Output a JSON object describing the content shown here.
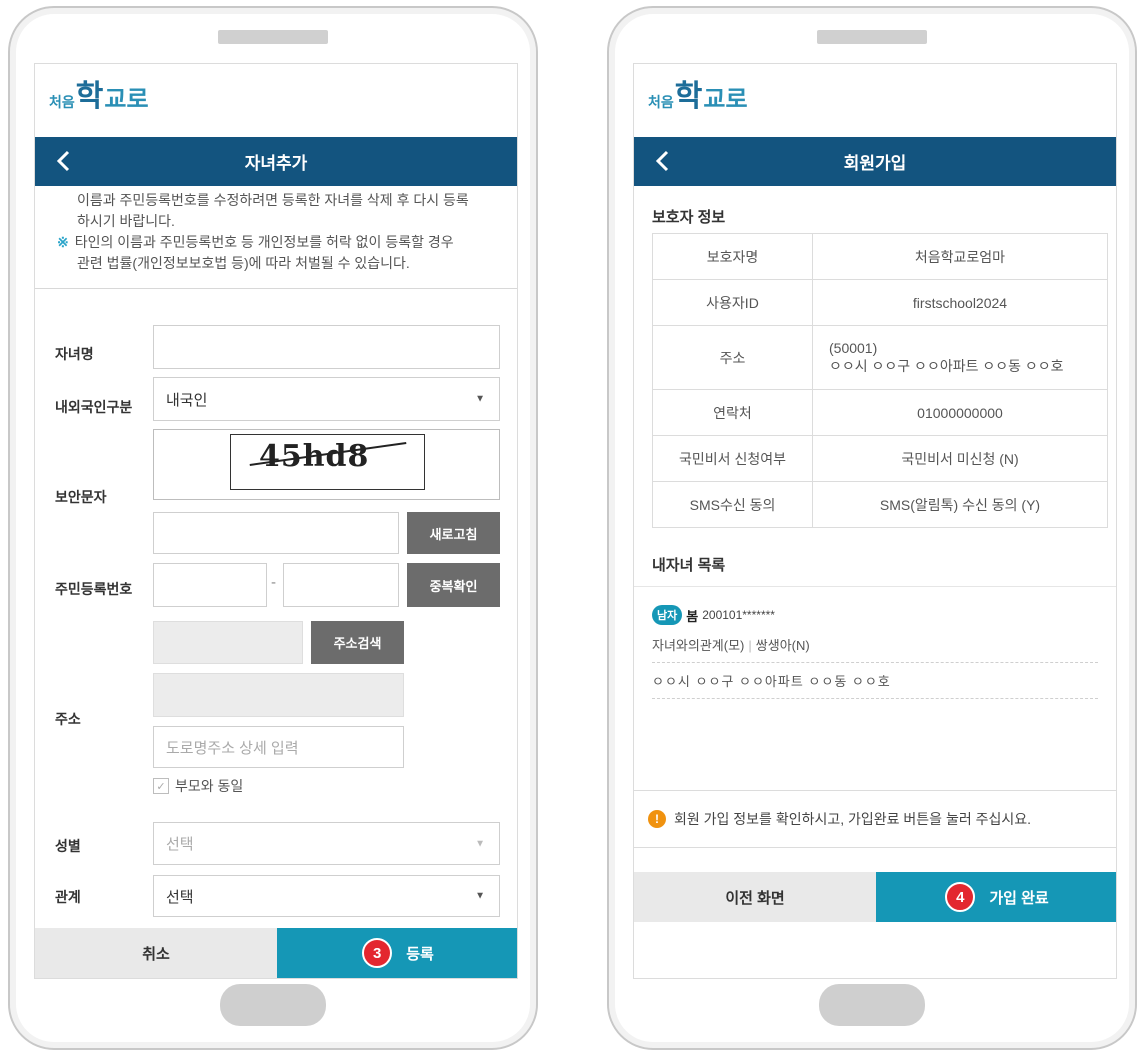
{
  "logo": {
    "part1": "처음",
    "part2": "학",
    "part3": "교로"
  },
  "left": {
    "header": {
      "title": "자녀추가"
    },
    "notice": {
      "line1": "이름과 주민등록번호를 수정하려면 등록한 자녀를 삭제 후 다시 등록",
      "line2": "하시기 바랍니다.",
      "mark": "※",
      "line3": "타인의 이름과 주민등록번호 등 개인정보를 허락 없이 등록할 경우",
      "line4": "관련 법률(개인정보보호법 등)에 따라 처벌될 수 있습니다."
    },
    "form": {
      "child_name_label": "자녀명",
      "child_name_value": "",
      "nationality_label": "내외국인구분",
      "nationality_value": "내국인",
      "captcha_label": "보안문자",
      "captcha_text": "45hd8",
      "captcha_input": "",
      "refresh_button": "새로고침",
      "rrn_label": "주민등록번호",
      "rrn_dash": "-",
      "rrn_first": "",
      "rrn_second": "",
      "dup_check_button": "중복확인",
      "address_label": "주소",
      "address_search_button": "주소검색",
      "address_detail_placeholder": "도로명주소 상세 입력",
      "same_as_parent_label": "부모와 동일",
      "gender_label": "성별",
      "gender_value": "선택",
      "relation_label": "관계",
      "relation_value": "선택",
      "select_arrow": "▼"
    },
    "bottom": {
      "cancel": "취소",
      "step": "3",
      "submit": "등록"
    }
  },
  "right": {
    "header": {
      "title": "회원가입"
    },
    "guardian_section": "보호자 정보",
    "rows": {
      "name": {
        "key": "보호자명",
        "value": "처음학교로엄마"
      },
      "userid": {
        "key": "사용자ID",
        "value": "firstschool2024"
      },
      "address": {
        "key": "주소",
        "zip": "(50001)",
        "value": "ㅇㅇ시 ㅇㅇ구 ㅇㅇ아파트 ㅇㅇ동 ㅇㅇ호"
      },
      "phone": {
        "key": "연락처",
        "value": "01000000000"
      },
      "secretary": {
        "key": "국민비서 신청여부",
        "value": "국민비서 미신청 (N)"
      },
      "sms": {
        "key": "SMS수신 동의",
        "value": "SMS(알림톡) 수신 동의 (Y)"
      }
    },
    "children_section": "내자녀 목록",
    "child": {
      "gender": "남자",
      "name": "봄",
      "birth": "200101*******",
      "relation": "자녀와의관계(모)",
      "twin": "쌍생아(N)",
      "address": "ㅇㅇ시 ㅇㅇ구 ㅇㅇ아파트 ㅇㅇ동 ㅇㅇ호"
    },
    "notice": "회원 가입 정보를 확인하시고, 가입완료 버튼을 눌러 주십시요.",
    "bottom": {
      "prev": "이전 화면",
      "step": "4",
      "complete": "가입 완료"
    }
  }
}
